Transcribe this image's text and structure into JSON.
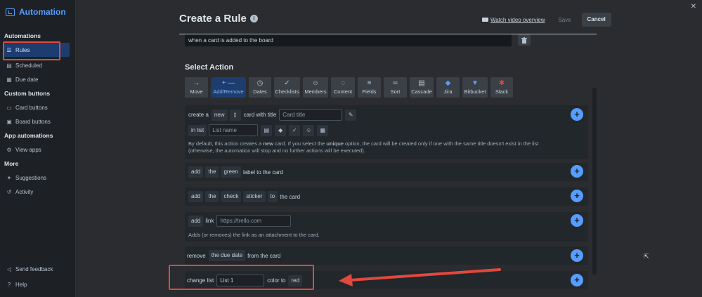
{
  "sidebar": {
    "brand": "Automation",
    "sections": [
      {
        "title": "Automations",
        "items": [
          {
            "label": "Rules",
            "icon": "sliders-icon",
            "glyph": "☰",
            "active": true
          },
          {
            "label": "Scheduled",
            "icon": "calendar-icon",
            "glyph": "▤"
          },
          {
            "label": "Due date",
            "icon": "clock-calendar-icon",
            "glyph": "▦"
          }
        ]
      },
      {
        "title": "Custom buttons",
        "items": [
          {
            "label": "Card buttons",
            "icon": "card-icon",
            "glyph": "▭"
          },
          {
            "label": "Board buttons",
            "icon": "board-icon",
            "glyph": "▣"
          }
        ]
      },
      {
        "title": "App automations",
        "items": [
          {
            "label": "View apps",
            "icon": "gear-icon",
            "glyph": "⚙"
          }
        ]
      },
      {
        "title": "More",
        "items": [
          {
            "label": "Suggestions",
            "icon": "sparkle-icon",
            "glyph": "✦"
          },
          {
            "label": "Activity",
            "icon": "history-icon",
            "glyph": "↺"
          }
        ]
      }
    ],
    "bottom": [
      {
        "label": "Send feedback",
        "icon": "megaphone-icon",
        "glyph": "◁"
      },
      {
        "label": "Help",
        "icon": "help-icon",
        "glyph": "?"
      }
    ]
  },
  "header": {
    "title": "Create a Rule",
    "info_glyph": "i",
    "video_link": "Watch video overview",
    "save": "Save",
    "cancel": "Cancel",
    "close_glyph": "✕"
  },
  "trigger": {
    "text": "when a card is added to the board",
    "trash_glyph": "🗑"
  },
  "select_action": "Select Action",
  "tabs": [
    {
      "label": "Move",
      "glyph": "→",
      "icon": "arrow-right-icon"
    },
    {
      "label": "Add/Remove",
      "glyph": "+ —",
      "icon": "plus-minus-icon",
      "active": true
    },
    {
      "label": "Dates",
      "glyph": "◷",
      "icon": "clock-icon"
    },
    {
      "label": "Checklists",
      "glyph": "✓",
      "icon": "check-icon"
    },
    {
      "label": "Members",
      "glyph": "☺",
      "icon": "person-icon"
    },
    {
      "label": "Content",
      "glyph": "◌",
      "icon": "comment-icon"
    },
    {
      "label": "Fields",
      "glyph": "≡",
      "icon": "fields-icon"
    },
    {
      "label": "Sort",
      "glyph": "≂",
      "icon": "sort-icon"
    },
    {
      "label": "Cascade",
      "glyph": "▤",
      "icon": "cascade-icon"
    },
    {
      "label": "Jira",
      "glyph": "◆",
      "icon": "jira-icon"
    },
    {
      "label": "Bitbucket",
      "glyph": "▼",
      "icon": "bitbucket-icon"
    },
    {
      "label": "Slack",
      "glyph": "✱",
      "icon": "slack-icon"
    }
  ],
  "actions": {
    "create": {
      "t1": "create a",
      "new": "new",
      "t2": "card with title",
      "title_placeholder": "Card title",
      "t3": "in list",
      "list_placeholder": "List name",
      "help_a": "By default, this action creates a ",
      "help_b": "new",
      "help_c": " card. If you select the ",
      "help_d": "unique",
      "help_e": " option, the card will be created only if one with the same title doesn't exist in the list (otherwise, the automation will stop and no further actions will be executed)."
    },
    "label": {
      "add": "add",
      "the": "the",
      "color": "green",
      "tail": "label to the card"
    },
    "sticker": {
      "add": "add",
      "the": "the",
      "sticker": "check",
      "word": "sticker",
      "to": "to",
      "tail": "the card"
    },
    "link": {
      "add": "add",
      "link": "link",
      "placeholder": "https://trello.com",
      "help": "Adds (or removes) the link as an attachment to the card."
    },
    "due": {
      "remove": "remove",
      "what": "the due date",
      "tail": "from the card"
    },
    "color": {
      "label": "change list",
      "list": "List 1",
      "mid": "color to",
      "color": "red"
    }
  },
  "plus_glyph": "+"
}
